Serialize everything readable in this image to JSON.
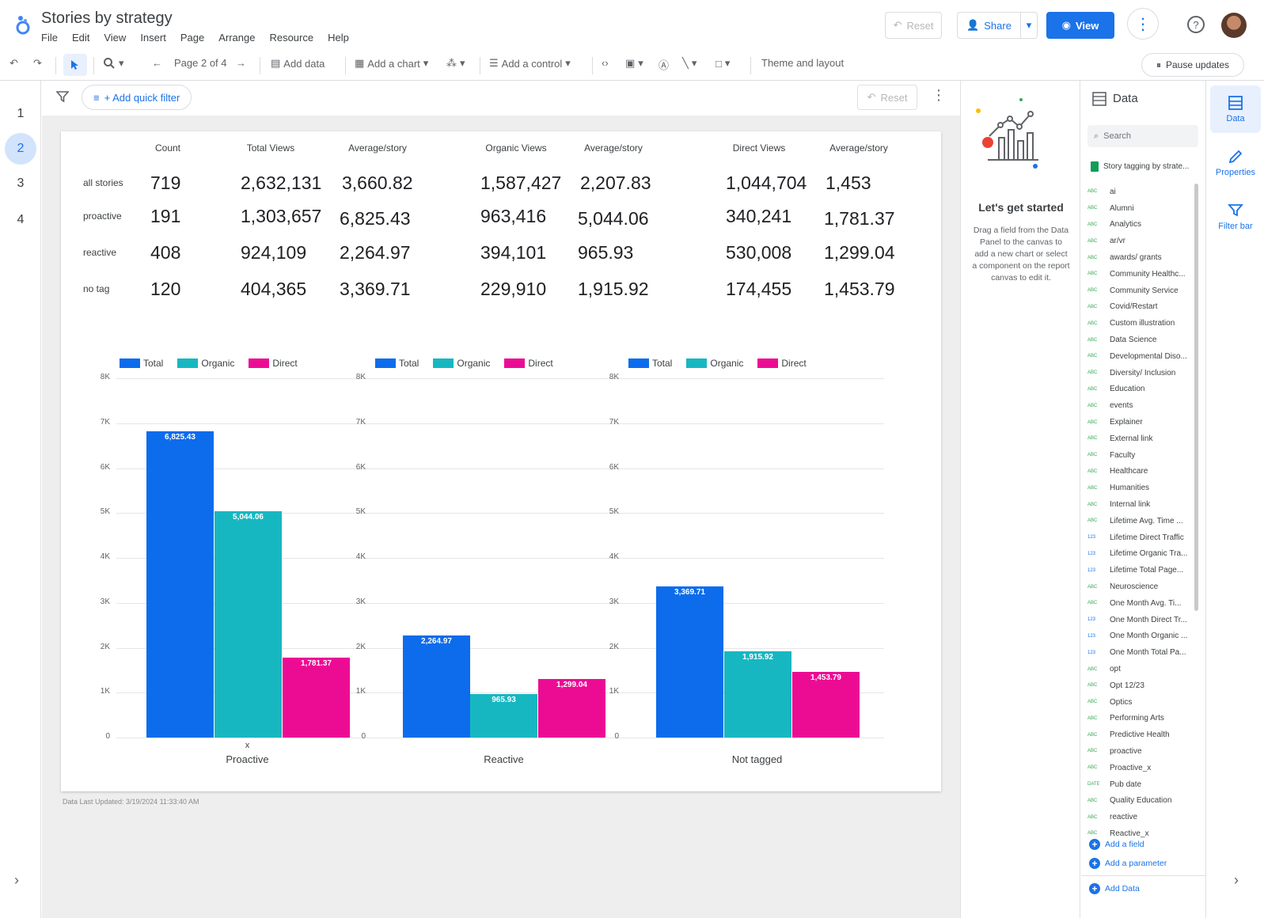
{
  "header": {
    "title": "Stories by strategy",
    "menu": [
      "File",
      "Edit",
      "View",
      "Insert",
      "Page",
      "Arrange",
      "Resource",
      "Help"
    ],
    "reset_label": "Reset",
    "share_label": "Share",
    "view_label": "View"
  },
  "toolbar": {
    "page_indicator": "Page 2 of 4",
    "add_data": "Add data",
    "add_chart": "Add a chart",
    "add_control": "Add a control",
    "theme_layout": "Theme and layout",
    "pause_updates": "Pause updates"
  },
  "pages": [
    "1",
    "2",
    "3",
    "4"
  ],
  "active_page": "2",
  "canvas": {
    "add_quick_filter": "+ Add quick filter",
    "reset_label": "Reset",
    "last_updated": "Data Last Updated: 3/19/2024 11:33:40 AM"
  },
  "table": {
    "headers": [
      "Count",
      "Total Views",
      "Average/story",
      "Organic Views",
      "Average/story",
      "Direct Views",
      "Average/story"
    ],
    "rows": [
      {
        "label": "all stories",
        "values": [
          "719",
          "2,632,131",
          "3,660.82",
          "1,587,427",
          "2,207.83",
          "1,044,704",
          "1,453"
        ]
      },
      {
        "label": "proactive",
        "values": [
          "191",
          "1,303,657",
          "6,825.43",
          "963,416",
          "5,044.06",
          "340,241",
          "1,781.37"
        ]
      },
      {
        "label": "reactive",
        "values": [
          "408",
          "924,109",
          "2,264.97",
          "394,101",
          "965.93",
          "530,008",
          "1,299.04"
        ]
      },
      {
        "label": "no tag",
        "values": [
          "120",
          "404,365",
          "3,369.71",
          "229,910",
          "1,915.92",
          "174,455",
          "1,453.79"
        ]
      }
    ]
  },
  "chart_data": {
    "type": "bar",
    "categories": [
      "Proactive",
      "Reactive",
      "Not tagged"
    ],
    "series": [
      {
        "name": "Total",
        "color": "#0c6cec",
        "values": [
          6825.43,
          2264.97,
          3369.71
        ],
        "labels": [
          "6,825.43",
          "2,264.97",
          "3,369.71"
        ]
      },
      {
        "name": "Organic",
        "color": "#17b7c1",
        "values": [
          5044.06,
          965.93,
          1915.92
        ],
        "labels": [
          "5,044.06",
          "965.93",
          "1,915.92"
        ]
      },
      {
        "name": "Direct",
        "color": "#ec0c94",
        "values": [
          1781.37,
          1299.04,
          1453.79
        ],
        "labels": [
          "1,781.37",
          "1,299.04",
          "1,453.79"
        ]
      }
    ],
    "yticks": [
      "0",
      "1K",
      "2K",
      "3K",
      "4K",
      "5K",
      "6K",
      "7K",
      "8K"
    ],
    "ylim": [
      0,
      8000
    ],
    "extra_x_label": "x",
    "grid": true,
    "legend_position": "top-left"
  },
  "get_started": {
    "title": "Let's get started",
    "body": "Drag a field from the Data Panel to the canvas to add a new chart or select a component on the report canvas to edit it."
  },
  "data_panel": {
    "title": "Data",
    "search_placeholder": "Search",
    "source": "Story tagging by strate...",
    "fields": [
      {
        "type": "ABC",
        "name": "ai"
      },
      {
        "type": "ABC",
        "name": "Alumni"
      },
      {
        "type": "ABC",
        "name": "Analytics"
      },
      {
        "type": "ABC",
        "name": "ar/vr"
      },
      {
        "type": "ABC",
        "name": "awards/ grants"
      },
      {
        "type": "ABC",
        "name": "Community Healthc..."
      },
      {
        "type": "ABC",
        "name": "Community Service"
      },
      {
        "type": "ABC",
        "name": "Covid/Restart"
      },
      {
        "type": "ABC",
        "name": "Custom illustration"
      },
      {
        "type": "ABC",
        "name": "Data Science"
      },
      {
        "type": "ABC",
        "name": "Developmental Diso..."
      },
      {
        "type": "ABC",
        "name": "Diversity/ Inclusion"
      },
      {
        "type": "ABC",
        "name": "Education"
      },
      {
        "type": "ABC",
        "name": "events"
      },
      {
        "type": "ABC",
        "name": "Explainer"
      },
      {
        "type": "ABC",
        "name": "External link"
      },
      {
        "type": "ABC",
        "name": "Faculty"
      },
      {
        "type": "ABC",
        "name": "Healthcare"
      },
      {
        "type": "ABC",
        "name": "Humanities"
      },
      {
        "type": "ABC",
        "name": "Internal link"
      },
      {
        "type": "ABC",
        "name": "Lifetime Avg. Time ..."
      },
      {
        "type": "123",
        "name": "Lifetime Direct Traffic"
      },
      {
        "type": "123",
        "name": "Lifetime Organic Tra..."
      },
      {
        "type": "123",
        "name": "Lifetime Total Page..."
      },
      {
        "type": "ABC",
        "name": "Neuroscience"
      },
      {
        "type": "ABC",
        "name": "One Month Avg. Ti..."
      },
      {
        "type": "123",
        "name": "One Month Direct Tr..."
      },
      {
        "type": "123",
        "name": "One Month Organic ..."
      },
      {
        "type": "123",
        "name": "One Month Total Pa..."
      },
      {
        "type": "ABC",
        "name": "opt"
      },
      {
        "type": "ABC",
        "name": "Opt 12/23"
      },
      {
        "type": "ABC",
        "name": "Optics"
      },
      {
        "type": "ABC",
        "name": "Performing Arts"
      },
      {
        "type": "ABC",
        "name": "Predictive Health"
      },
      {
        "type": "ABC",
        "name": "proactive"
      },
      {
        "type": "ABC",
        "name": "Proactive_x"
      },
      {
        "type": "DATE",
        "name": "Pub date"
      },
      {
        "type": "ABC",
        "name": "Quality Education"
      },
      {
        "type": "ABC",
        "name": "reactive"
      },
      {
        "type": "ABC",
        "name": "Reactive_x"
      }
    ],
    "add_field": "Add a field",
    "add_parameter": "Add a parameter",
    "add_data": "Add Data"
  },
  "right_rail": [
    {
      "label": "Data",
      "icon": "data-icon"
    },
    {
      "label": "Properties",
      "icon": "pencil-icon"
    },
    {
      "label": "Filter bar",
      "icon": "filter-icon"
    }
  ],
  "colors": {
    "accent": "#1a73e8",
    "total": "#0c6cec",
    "organic": "#17b7c1",
    "direct": "#ec0c94"
  }
}
